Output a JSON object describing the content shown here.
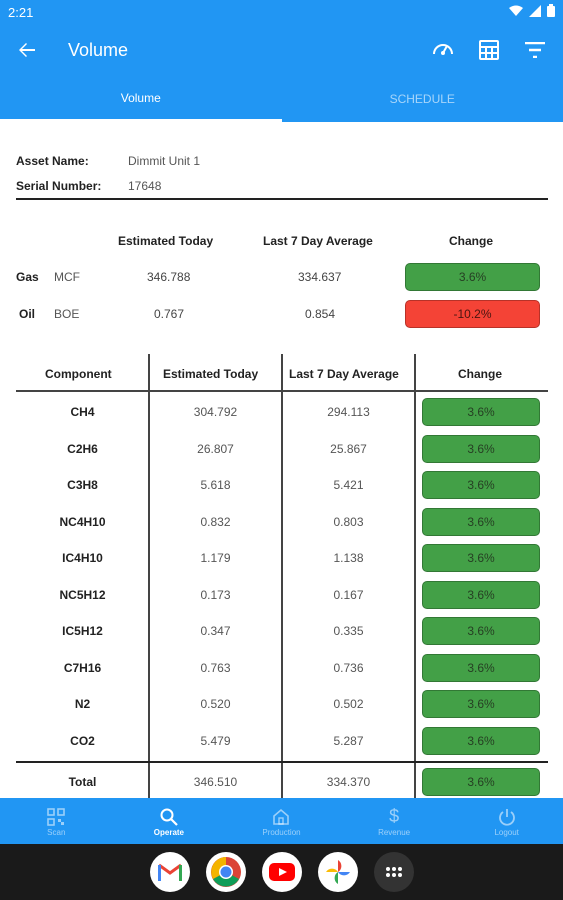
{
  "status": {
    "time": "2:21"
  },
  "appbar": {
    "title": "Volume"
  },
  "tabs": [
    {
      "label": "Volume",
      "active": true
    },
    {
      "label": "SCHEDULE",
      "active": false
    }
  ],
  "asset": {
    "name_label": "Asset Name:",
    "name_value": "Dimmit Unit 1",
    "serial_label": "Serial Number:",
    "serial_value": "17648"
  },
  "summary": {
    "headers": {
      "estimated": "Estimated Today",
      "average": "Last 7 Day Average",
      "change": "Change"
    },
    "rows": [
      {
        "label": "Gas",
        "unit": "MCF",
        "estimated": "346.788",
        "average": "334.637",
        "change": "3.6%",
        "status": "green"
      },
      {
        "label": "Oil",
        "unit": "BOE",
        "estimated": "0.767",
        "average": "0.854",
        "change": "-10.2%",
        "status": "red"
      }
    ]
  },
  "components": {
    "headers": {
      "component": "Component",
      "estimated": "Estimated Today",
      "average": "Last 7 Day Average",
      "change": "Change"
    },
    "rows": [
      {
        "name": "CH4",
        "estimated": "304.792",
        "average": "294.113",
        "change": "3.6%"
      },
      {
        "name": "C2H6",
        "estimated": "26.807",
        "average": "25.867",
        "change": "3.6%"
      },
      {
        "name": "C3H8",
        "estimated": "5.618",
        "average": "5.421",
        "change": "3.6%"
      },
      {
        "name": "NC4H10",
        "estimated": "0.832",
        "average": "0.803",
        "change": "3.6%"
      },
      {
        "name": "IC4H10",
        "estimated": "1.179",
        "average": "1.138",
        "change": "3.6%"
      },
      {
        "name": "NC5H12",
        "estimated": "0.173",
        "average": "0.167",
        "change": "3.6%"
      },
      {
        "name": "IC5H12",
        "estimated": "0.347",
        "average": "0.335",
        "change": "3.6%"
      },
      {
        "name": "C7H16",
        "estimated": "0.763",
        "average": "0.736",
        "change": "3.6%"
      },
      {
        "name": "N2",
        "estimated": "0.520",
        "average": "0.502",
        "change": "3.6%"
      },
      {
        "name": "CO2",
        "estimated": "5.479",
        "average": "5.287",
        "change": "3.6%"
      }
    ],
    "total": {
      "name": "Total",
      "estimated": "346.510",
      "average": "334.370",
      "change": "3.6%"
    }
  },
  "bottom_nav": [
    {
      "label": "Scan",
      "icon": "qr-code-icon",
      "active": false
    },
    {
      "label": "Operate",
      "icon": "search-icon",
      "active": true
    },
    {
      "label": "Production",
      "icon": "home-icon",
      "active": false
    },
    {
      "label": "Revenue",
      "icon": "dollar-icon",
      "active": false
    },
    {
      "label": "Logout",
      "icon": "power-icon",
      "active": false
    }
  ],
  "dock_apps": [
    "gmail-icon",
    "chrome-icon",
    "youtube-icon",
    "photos-icon",
    "app-drawer-icon"
  ],
  "colors": {
    "primary": "#2196f3",
    "positive": "#43a047",
    "negative": "#f44336"
  }
}
